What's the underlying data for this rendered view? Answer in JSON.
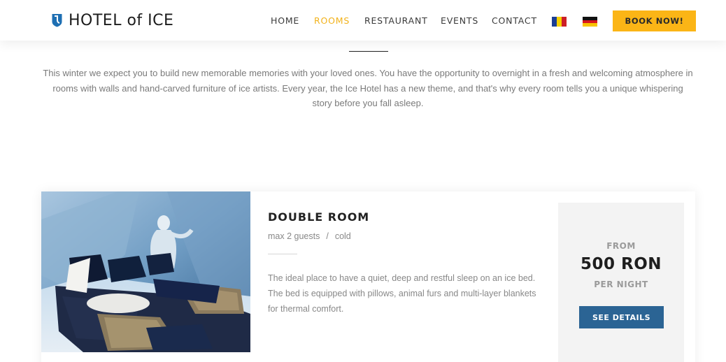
{
  "header": {
    "logo_text": "HOTEL of ICE",
    "nav": [
      {
        "label": "HOME",
        "active": false
      },
      {
        "label": "ROOMS",
        "active": true
      },
      {
        "label": "RESTAURANT",
        "active": false
      },
      {
        "label": "EVENTS",
        "active": false
      },
      {
        "label": "CONTACT",
        "active": false
      }
    ],
    "flags": [
      "romania-flag-icon",
      "germany-flag-icon"
    ],
    "book_label": "BOOK NOW!"
  },
  "intro": {
    "text": "This winter we expect you to build new memorable memories with your loved ones. You have the opportunity to overnight in a fresh and welcoming atmosphere in rooms with walls and hand-carved furniture of ice artists. Every year, the Ice Hotel has a new theme, and that's why every room tells you a unique whispering story before you fall asleep."
  },
  "room": {
    "title": "DOUBLE ROOM",
    "guests": "max 2 guests",
    "separator": "/",
    "temperature": "cold",
    "description": "The ideal place to have a quiet, deep and restful sleep on an ice bed. The bed is equipped with pillows, animal furs and multi-layer blankets for thermal comfort.",
    "price_from": "FROM",
    "price": "500 RON",
    "price_unit": "PER NIGHT",
    "details_label": "SEE DETAILS"
  },
  "colors": {
    "accent": "#fbb516",
    "active_nav": "#f2b21b",
    "button_blue": "#2b6494",
    "logo_blue": "#1e6fb3"
  }
}
